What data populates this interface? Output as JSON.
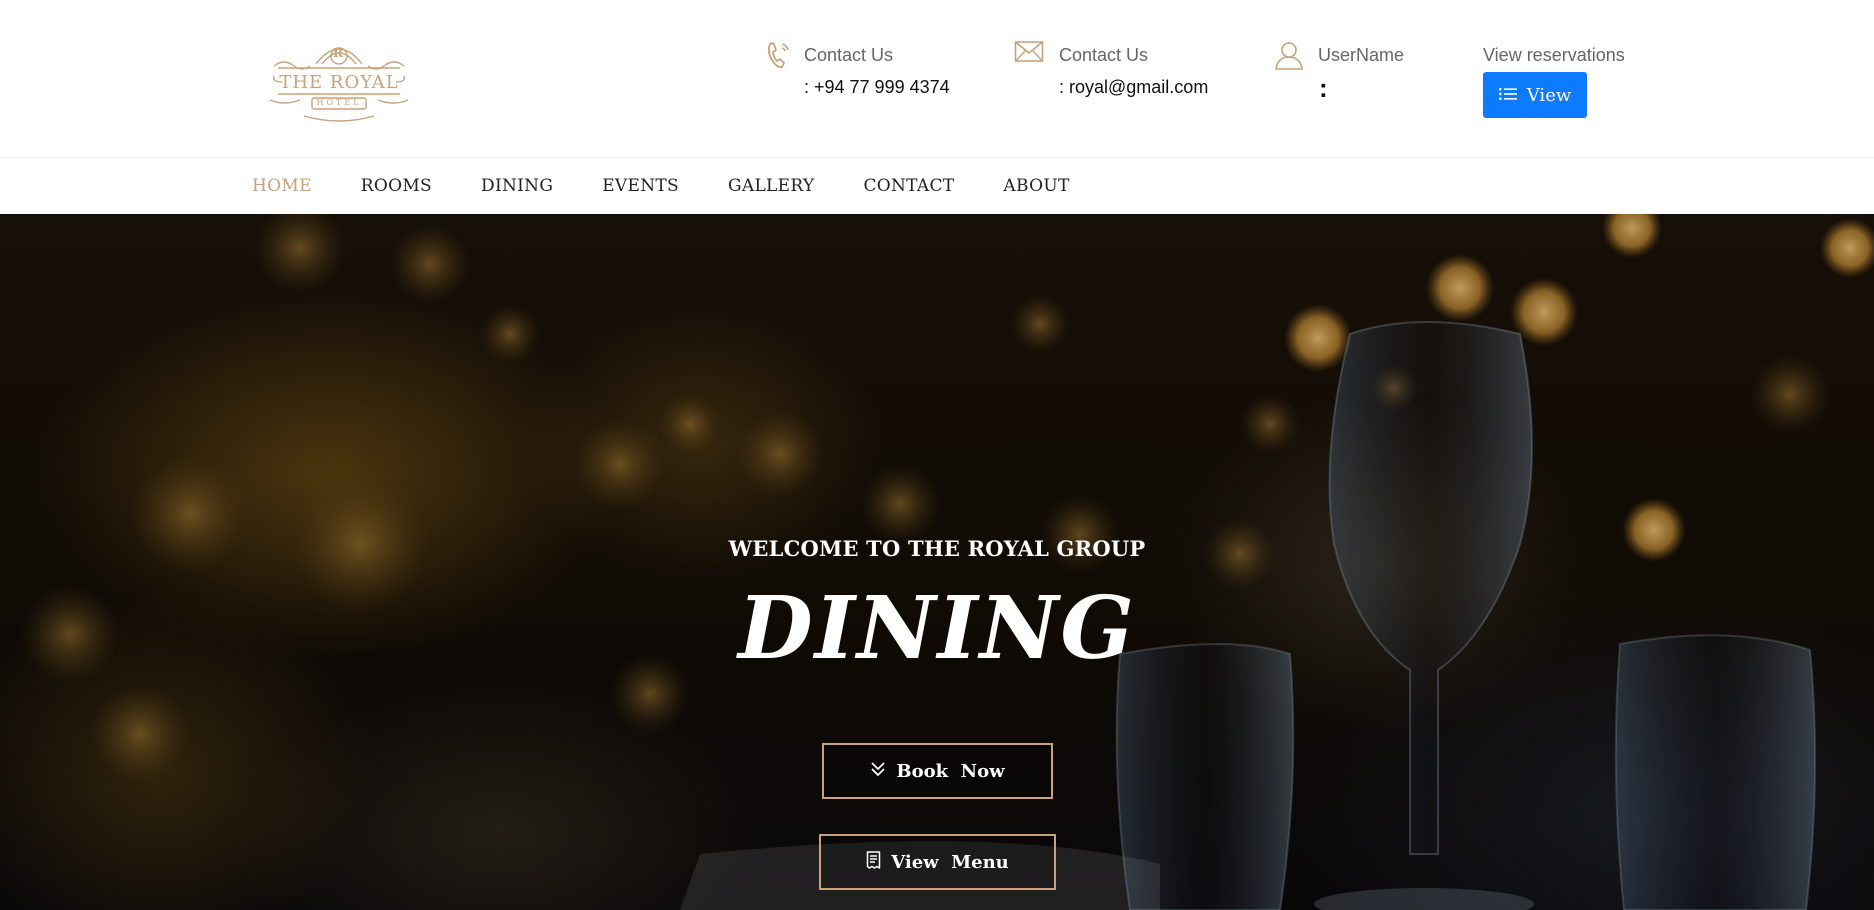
{
  "brand": {
    "logo_title": "THE ROYAL",
    "logo_sub": "HOTEL",
    "logo_monogram": "R",
    "logo_color": "#c8a27a"
  },
  "header": {
    "phone": {
      "icon": "phone-icon",
      "title": "Contact Us",
      "value": ": +94 77 999 4374"
    },
    "email": {
      "icon": "mail-icon",
      "title": "Contact Us",
      "value": ": royal@gmail.com"
    },
    "user": {
      "icon": "user-icon",
      "title": "UserName",
      "value": ":"
    },
    "reservations": {
      "title": "View reservations",
      "button_label": "View",
      "button_icon": "list-icon",
      "button_color": "#0d7bff"
    }
  },
  "nav": {
    "items": [
      {
        "label": "HOME",
        "active": true
      },
      {
        "label": "ROOMS",
        "active": false
      },
      {
        "label": "DINING",
        "active": false
      },
      {
        "label": "EVENTS",
        "active": false
      },
      {
        "label": "GALLERY",
        "active": false
      },
      {
        "label": "CONTACT",
        "active": false
      },
      {
        "label": "ABOUT",
        "active": false
      }
    ],
    "active_color": "#c8a27a"
  },
  "hero": {
    "subtitle": "WELCOME TO THE ROYAL GROUP",
    "title": "DINING",
    "book_button": {
      "label": "Book  Now",
      "icon": "double-chevron-down-icon"
    },
    "menu_button": {
      "label": "View  Menu",
      "icon": "receipt-icon"
    },
    "border_color": "#c8a27a"
  }
}
